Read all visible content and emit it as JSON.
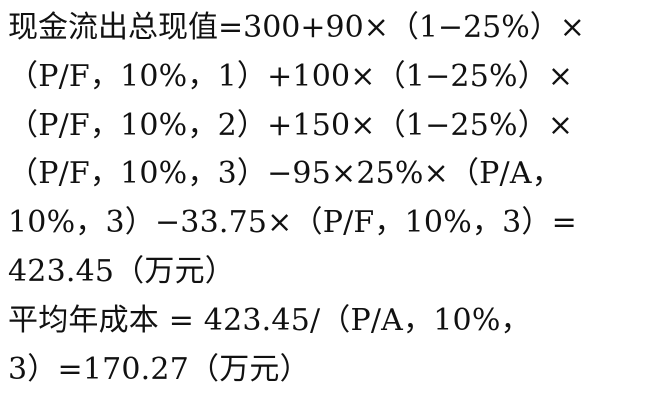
{
  "document": {
    "lines": [
      "现金流出总现值=300+90×（1−25%）×",
      "（P/F，10%，1）+100×（1−25%）×",
      "（P/F，10%，2）+150×（1−25%）×",
      "（P/F，10%，3）−95×25%×（P/A，",
      "10%，3）−33.75×（P/F，10%，3）=",
      "423.45（万元）",
      "平均年成本 = 423.45/（P/A，10%，",
      "3）=170.27（万元）"
    ]
  }
}
